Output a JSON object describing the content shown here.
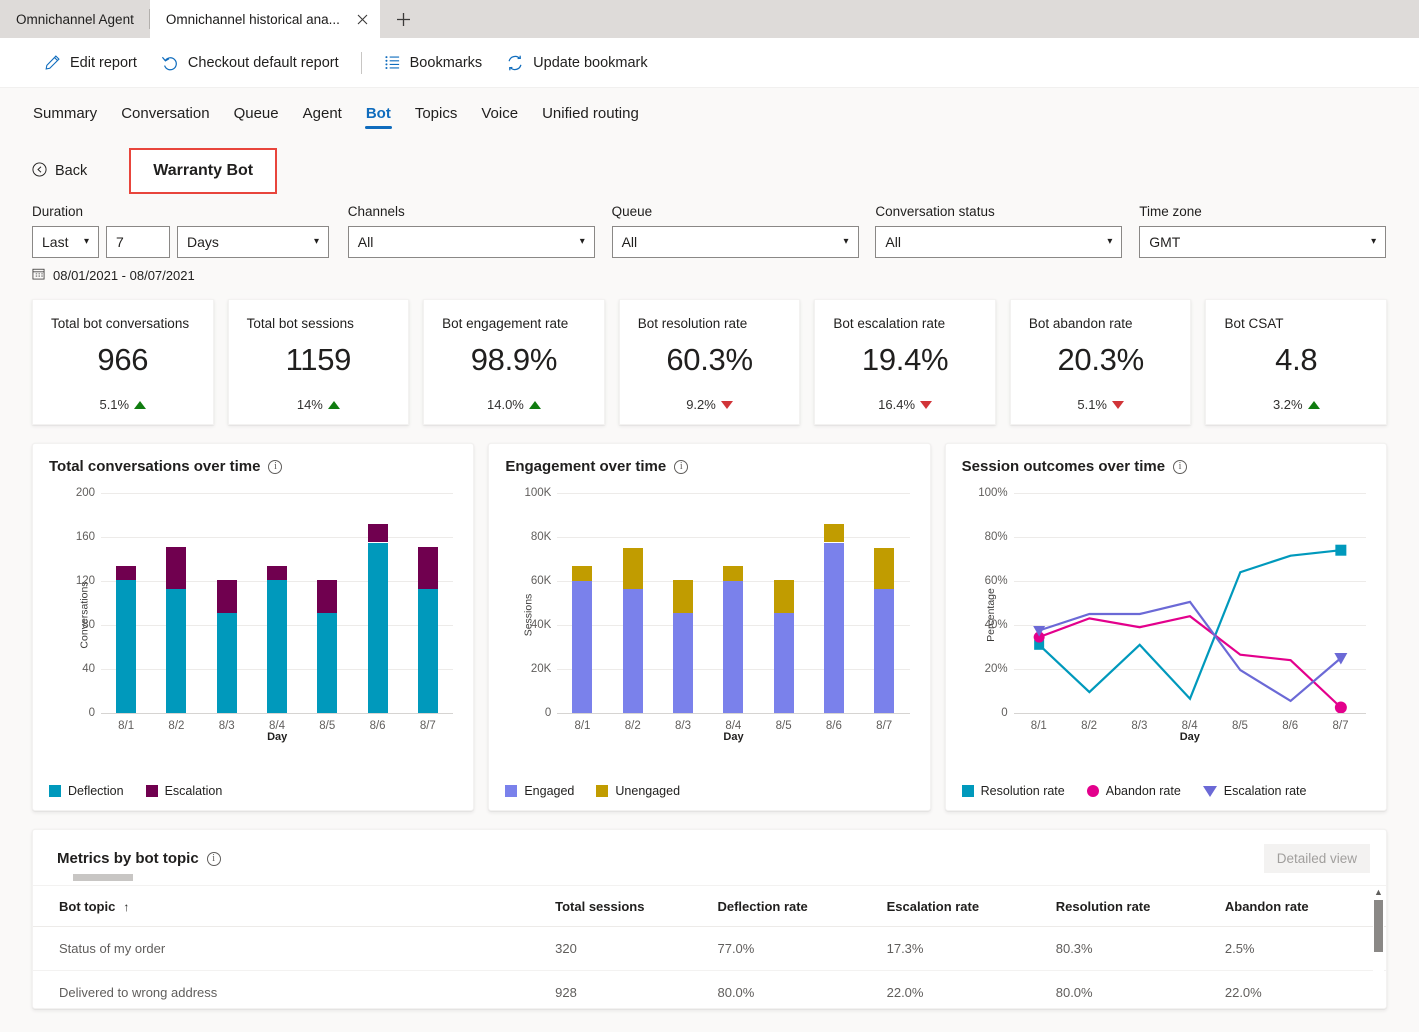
{
  "browser": {
    "tabs": [
      {
        "title": "Omnichannel Agent",
        "active": false
      },
      {
        "title": "Omnichannel historical ana...",
        "active": true
      }
    ],
    "close_icon": "close-icon",
    "newtab_label": "+"
  },
  "commandbar": {
    "items": [
      {
        "label": "Edit report",
        "icon": "pencil-icon"
      },
      {
        "label": "Checkout default report",
        "icon": "undo-icon"
      },
      {
        "label": "Bookmarks",
        "icon": "bookmark-list-icon"
      },
      {
        "label": "Update bookmark",
        "icon": "refresh-icon"
      }
    ]
  },
  "navtabs": [
    {
      "label": "Summary",
      "selected": false
    },
    {
      "label": "Conversation",
      "selected": false
    },
    {
      "label": "Queue",
      "selected": false
    },
    {
      "label": "Agent",
      "selected": false
    },
    {
      "label": "Bot",
      "selected": true
    },
    {
      "label": "Topics",
      "selected": false
    },
    {
      "label": "Voice",
      "selected": false
    },
    {
      "label": "Unified routing",
      "selected": false
    }
  ],
  "backrow": {
    "back_label": "Back",
    "back_icon": "back-circle-icon",
    "bot_name": "Warranty Bot",
    "highlight_color": "#e8453c"
  },
  "filters": {
    "duration": {
      "label": "Duration",
      "relative_value": "Last",
      "amount_value": "7",
      "unit_value": "Days"
    },
    "channels": {
      "label": "Channels",
      "value": "All"
    },
    "queue": {
      "label": "Queue",
      "value": "All"
    },
    "conversation_status": {
      "label": "Conversation status",
      "value": "All"
    },
    "time_zone": {
      "label": "Time zone",
      "value": "GMT"
    },
    "date_range": "08/01/2021 - 08/07/2021",
    "calendar_icon": "calendar-icon"
  },
  "kpis": [
    {
      "title": "Total bot conversations",
      "value": "966",
      "delta": "5.1%",
      "direction": "up"
    },
    {
      "title": "Total bot sessions",
      "value": "1159",
      "delta": "14%",
      "direction": "up"
    },
    {
      "title": "Bot engagement rate",
      "value": "98.9%",
      "delta": "14.0%",
      "direction": "up"
    },
    {
      "title": "Bot resolution rate",
      "value": "60.3%",
      "delta": "9.2%",
      "direction": "down"
    },
    {
      "title": "Bot escalation rate",
      "value": "19.4%",
      "delta": "16.4%",
      "direction": "down"
    },
    {
      "title": "Bot abandon rate",
      "value": "20.3%",
      "delta": "5.1%",
      "direction": "down"
    },
    {
      "title": "Bot CSAT",
      "value": "4.8",
      "delta": "3.2%",
      "direction": "up"
    }
  ],
  "chart_data": [
    {
      "type": "bar",
      "stacked": true,
      "title": "Total conversations over time",
      "xlabel": "Day",
      "ylabel": "Conversations",
      "categories": [
        "8/1",
        "8/2",
        "8/3",
        "8/4",
        "8/5",
        "8/6",
        "8/7"
      ],
      "ylim": [
        0,
        200
      ],
      "yticks": [
        0,
        40,
        80,
        120,
        160,
        200
      ],
      "ytick_labels": [
        "0",
        "40",
        "80",
        "120",
        "160",
        "200"
      ],
      "grid": true,
      "legend_position": "bottom-left",
      "series": [
        {
          "name": "Deflection",
          "color": "#0099bc",
          "values": [
            121,
            113,
            91,
            121,
            91,
            155,
            113
          ]
        },
        {
          "name": "Escalation",
          "color": "#70004f",
          "values": [
            13,
            38,
            30,
            13,
            30,
            17,
            38
          ]
        }
      ]
    },
    {
      "type": "bar",
      "stacked": true,
      "title": "Engagement over time",
      "xlabel": "Day",
      "ylabel": "Sessions",
      "categories": [
        "8/1",
        "8/2",
        "8/3",
        "8/4",
        "8/5",
        "8/6",
        "8/7"
      ],
      "ylim": [
        0,
        100000
      ],
      "yticks": [
        0,
        20000,
        40000,
        60000,
        80000,
        100000
      ],
      "ytick_labels": [
        "0",
        "20K",
        "40K",
        "60K",
        "80K",
        "100K"
      ],
      "grid": true,
      "legend_position": "bottom-left",
      "series": [
        {
          "name": "Engaged",
          "color": "#7a81eb",
          "values": [
            60000,
            56500,
            45500,
            60000,
            45500,
            77500,
            56500
          ]
        },
        {
          "name": "Unengaged",
          "color": "#c19c00",
          "values": [
            7000,
            18500,
            15000,
            7000,
            15000,
            8500,
            18500
          ]
        }
      ]
    },
    {
      "type": "line",
      "title": "Session outcomes over time",
      "xlabel": "Day",
      "ylabel": "Percentage",
      "categories": [
        "8/1",
        "8/2",
        "8/3",
        "8/4",
        "8/5",
        "8/6",
        "8/7"
      ],
      "ylim": [
        0,
        100
      ],
      "yticks": [
        0,
        20,
        40,
        60,
        80,
        100
      ],
      "ytick_labels": [
        "0",
        "20%",
        "40%",
        "60%",
        "80%",
        "100%"
      ],
      "grid": true,
      "legend_position": "bottom-left",
      "series": [
        {
          "name": "Resolution rate",
          "color": "#0099bc",
          "marker": "square",
          "values": [
            31,
            9.5,
            31,
            6.5,
            64,
            71.5,
            74
          ]
        },
        {
          "name": "Abandon rate",
          "color": "#e3008c",
          "marker": "circle",
          "values": [
            34.5,
            43,
            39,
            44,
            26.5,
            24,
            2.5
          ]
        },
        {
          "name": "Escalation rate",
          "color": "#6b69d6",
          "marker": "triangle",
          "values": [
            37.5,
            45,
            45,
            50.5,
            19.5,
            5.5,
            25
          ]
        }
      ]
    }
  ],
  "table": {
    "title": "Metrics by bot topic",
    "detailed_view_label": "Detailed view",
    "sort_column": "Bot topic",
    "sort_direction": "ascending",
    "sort_icon": "arrow-up-icon",
    "columns": [
      "Bot topic",
      "Total sessions",
      "Deflection rate",
      "Escalation rate",
      "Resolution rate",
      "Abandon rate"
    ],
    "rows": [
      [
        "Status of my order",
        "320",
        "77.0%",
        "17.3%",
        "80.3%",
        "2.5%"
      ],
      [
        "Delivered to wrong address",
        "928",
        "80.0%",
        "22.0%",
        "80.0%",
        "22.0%"
      ]
    ]
  }
}
